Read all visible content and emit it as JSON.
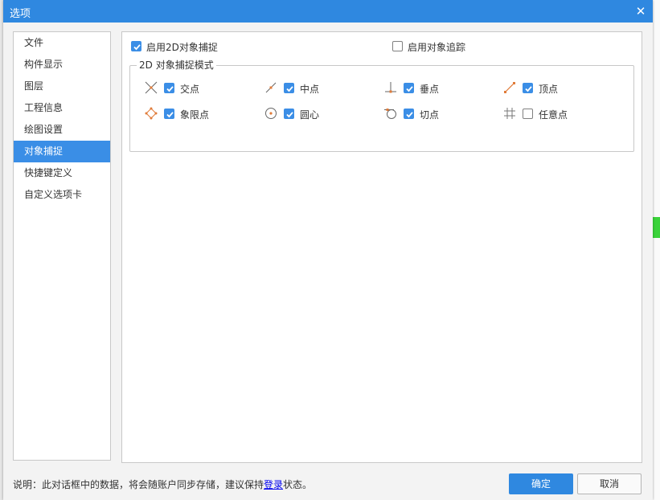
{
  "dialog": {
    "title": "选项",
    "close_glyph": "✕"
  },
  "sidebar": {
    "items": [
      {
        "label": "文件",
        "active": false
      },
      {
        "label": "构件显示",
        "active": false
      },
      {
        "label": "图层",
        "active": false
      },
      {
        "label": "工程信息",
        "active": false
      },
      {
        "label": "绘图设置",
        "active": false
      },
      {
        "label": "对象捕捉",
        "active": true
      },
      {
        "label": "快捷键定义",
        "active": false
      },
      {
        "label": "自定义选项卡",
        "active": false
      }
    ]
  },
  "panel": {
    "enable_2d_snap": {
      "label": "启用2D对象捕捉",
      "checked": true
    },
    "enable_tracking": {
      "label": "启用对象追踪",
      "checked": false
    },
    "mode_group_title": "2D 对象捕捉模式",
    "modes": [
      {
        "label": "交点",
        "checked": true,
        "icon": "intersection-icon"
      },
      {
        "label": "中点",
        "checked": true,
        "icon": "midpoint-icon"
      },
      {
        "label": "垂点",
        "checked": true,
        "icon": "perpendicular-icon"
      },
      {
        "label": "顶点",
        "checked": true,
        "icon": "endpoint-icon"
      },
      {
        "label": "象限点",
        "checked": true,
        "icon": "quadrant-icon"
      },
      {
        "label": "圆心",
        "checked": true,
        "icon": "center-icon"
      },
      {
        "label": "切点",
        "checked": true,
        "icon": "tangent-icon"
      },
      {
        "label": "任意点",
        "checked": false,
        "icon": "grid-icon"
      }
    ]
  },
  "footer": {
    "note_prefix": "说明：此对话框中的数据，将会随账户同步存储，建议保持",
    "note_link": "登录",
    "note_suffix": "状态。",
    "ok_label": "确定",
    "cancel_label": "取消"
  },
  "colors": {
    "accent": "#2f88e0",
    "sidebar_active": "#3a8ee6",
    "checkbox_on": "#3b8ee6",
    "icon_orange": "#e07b39"
  }
}
